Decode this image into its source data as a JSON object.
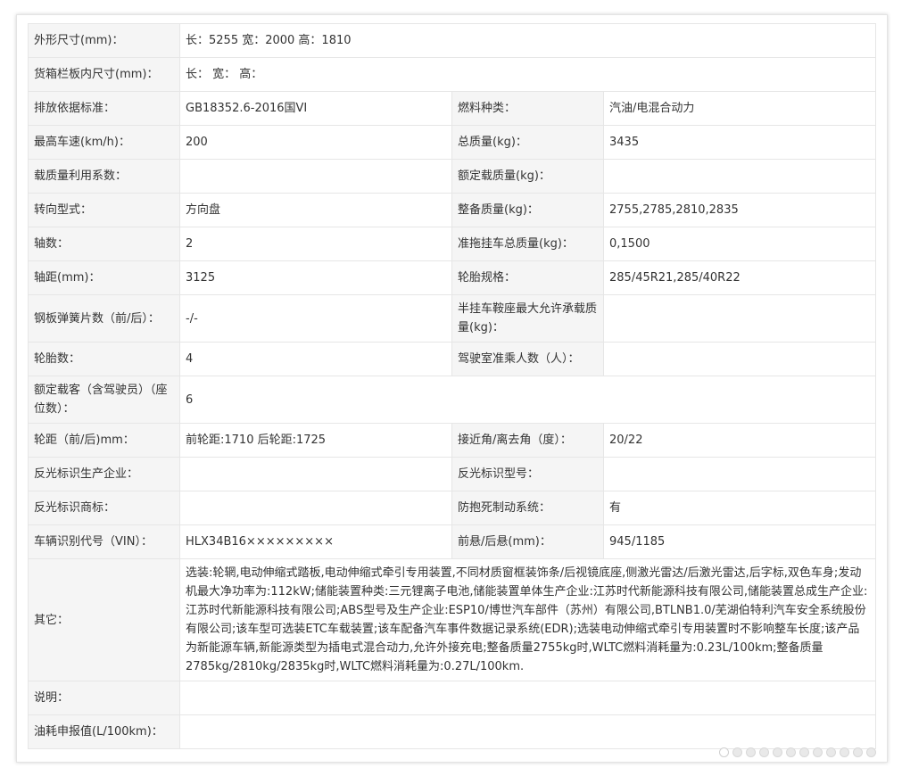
{
  "rows": [
    {
      "l1": "外形尺寸(mm)：",
      "v1": "长：5255 宽：2000 高：1810"
    },
    {
      "l1": "货箱栏板内尺寸(mm)：",
      "v1": "长： 宽： 高："
    },
    {
      "l1": "排放依据标准：",
      "v1": "GB18352.6-2016国VI",
      "l2": "燃料种类：",
      "v2": "汽油/电混合动力"
    },
    {
      "l1": "最高车速(km/h)：",
      "v1": "200",
      "l2": "总质量(kg)：",
      "v2": "3435"
    },
    {
      "l1": "载质量利用系数：",
      "v1": "",
      "l2": "额定载质量(kg)：",
      "v2": ""
    },
    {
      "l1": "转向型式：",
      "v1": "方向盘",
      "l2": "整备质量(kg)：",
      "v2": "2755,2785,2810,2835"
    },
    {
      "l1": "轴数：",
      "v1": "2",
      "l2": "准拖挂车总质量(kg)：",
      "v2": "0,1500"
    },
    {
      "l1": "轴距(mm)：",
      "v1": "3125",
      "l2": "轮胎规格：",
      "v2": "285/45R21,285/40R22"
    },
    {
      "l1": "钢板弹簧片数（前/后）：",
      "v1": "-/-",
      "l2": "半挂车鞍座最大允许承载质量(kg)：",
      "v2": ""
    },
    {
      "l1": "轮胎数：",
      "v1": "4",
      "l2": "驾驶室准乘人数（人）：",
      "v2": ""
    },
    {
      "l1": "额定载客（含驾驶员）（座位数）：",
      "v1": "6"
    },
    {
      "l1": "轮距（前/后)mm：",
      "v1": "前轮距:1710 后轮距:1725",
      "l2": "接近角/离去角（度）：",
      "v2": "20/22"
    },
    {
      "l1": "反光标识生产企业：",
      "v1": "",
      "l2": "反光标识型号：",
      "v2": ""
    },
    {
      "l1": "反光标识商标：",
      "v1": "",
      "l2": "防抱死制动系统：",
      "v2": "有"
    },
    {
      "l1": "车辆识别代号（VIN）：",
      "v1": "HLX34B16×××××××××",
      "l2": "前悬/后悬(mm)：",
      "v2": "945/1185"
    },
    {
      "l1": "其它：",
      "v1": "选装:轮辋,电动伸缩式踏板,电动伸缩式牵引专用装置,不同材质窗框装饰条/后视镜底座,侧激光雷达/后激光雷达,后字标,双色车身;发动机最大净功率为:112kW;储能装置种类:三元锂离子电池,储能装置单体生产企业:江苏时代新能源科技有限公司,储能装置总成生产企业:江苏时代新能源科技有限公司;ABS型号及生产企业:ESP10/博世汽车部件（苏州）有限公司,BTLNB1.0/芜湖伯特利汽车安全系统股份有限公司;该车型可选装ETC车载装置;该车配备汽车事件数据记录系统(EDR);选装电动伸缩式牵引专用装置时不影响整车长度;该产品为新能源车辆,新能源类型为插电式混合动力,允许外接充电;整备质量2755kg时,WLTC燃料消耗量为:0.23L/100km;整备质量2785kg/2810kg/2835kg时,WLTC燃料消耗量为:0.27L/100km."
    },
    {
      "l1": "说明：",
      "v1": ""
    },
    {
      "l1": "油耗申报值(L/100km)：",
      "v1": ""
    }
  ]
}
